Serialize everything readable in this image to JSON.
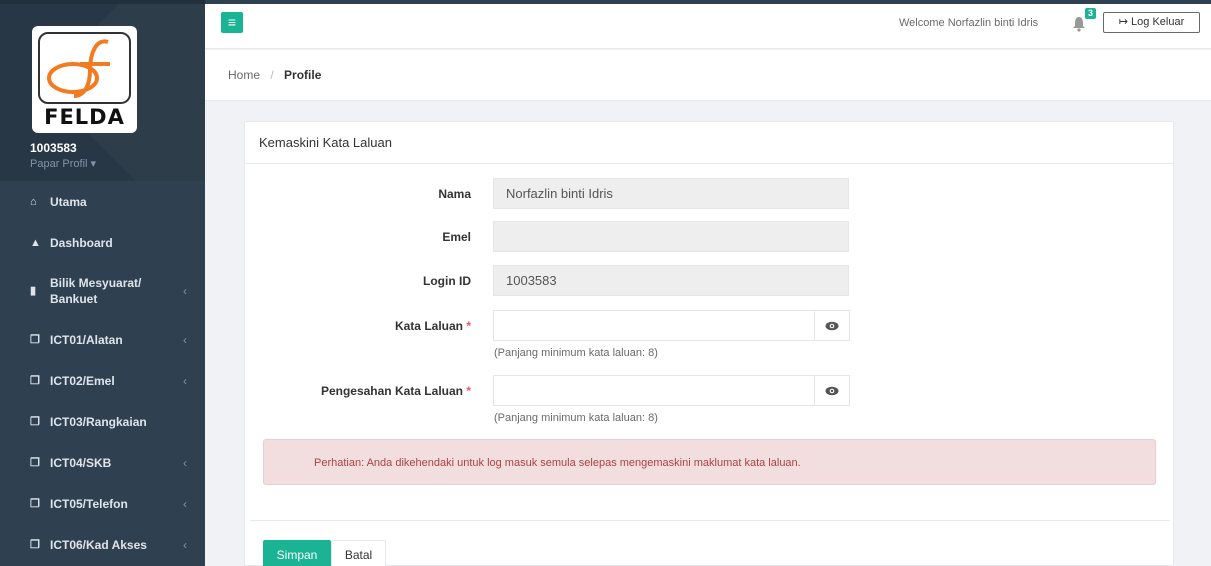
{
  "sidebar": {
    "logo_text": "FELDA",
    "user_id": "1003583",
    "profile_link": "Papar Profil ▾",
    "items": [
      {
        "label": "Utama",
        "icon": "home-icon"
      },
      {
        "label": "Dashboard",
        "icon": "chart-icon"
      },
      {
        "label": "Bilik Mesyuarat/ Bankuet",
        "icon": "building-icon"
      },
      {
        "label": "ICT01/Alatan",
        "icon": "copy-icon"
      },
      {
        "label": "ICT02/Emel",
        "icon": "copy-icon"
      },
      {
        "label": "ICT03/Rangkaian",
        "icon": "copy-icon"
      },
      {
        "label": "ICT04/SKB",
        "icon": "copy-icon"
      },
      {
        "label": "ICT05/Telefon",
        "icon": "copy-icon"
      },
      {
        "label": "ICT06/Kad Akses",
        "icon": "copy-icon"
      }
    ]
  },
  "topbar": {
    "welcome": "Welcome Norfazlin binti Idris",
    "notification_count": "3",
    "logout_label": "Log Keluar"
  },
  "breadcrumb": {
    "home": "Home",
    "current": "Profile"
  },
  "panel": {
    "title": "Kemaskini Kata Laluan",
    "nama_label": "Nama",
    "nama_value": "Norfazlin binti Idris",
    "emel_label": "Emel",
    "emel_value": "",
    "login_label": "Login ID",
    "login_value": "1003583",
    "password_label": "Kata Laluan",
    "password_help": "(Panjang minimum kata laluan: 8)",
    "confirm_label": "Pengesahan Kata Laluan",
    "confirm_help": "(Panjang minimum kata laluan: 8)",
    "required_mark": "*",
    "alert": "Perhatian: Anda dikehendaki untuk log masuk semula selepas mengemaskini maklumat kata laluan.",
    "save_label": "Simpan",
    "cancel_label": "Batal"
  },
  "colors": {
    "primary": "#1ab394",
    "sidebar": "#2f4050",
    "alert_bg": "#f2dede",
    "alert_text": "#a94442"
  }
}
